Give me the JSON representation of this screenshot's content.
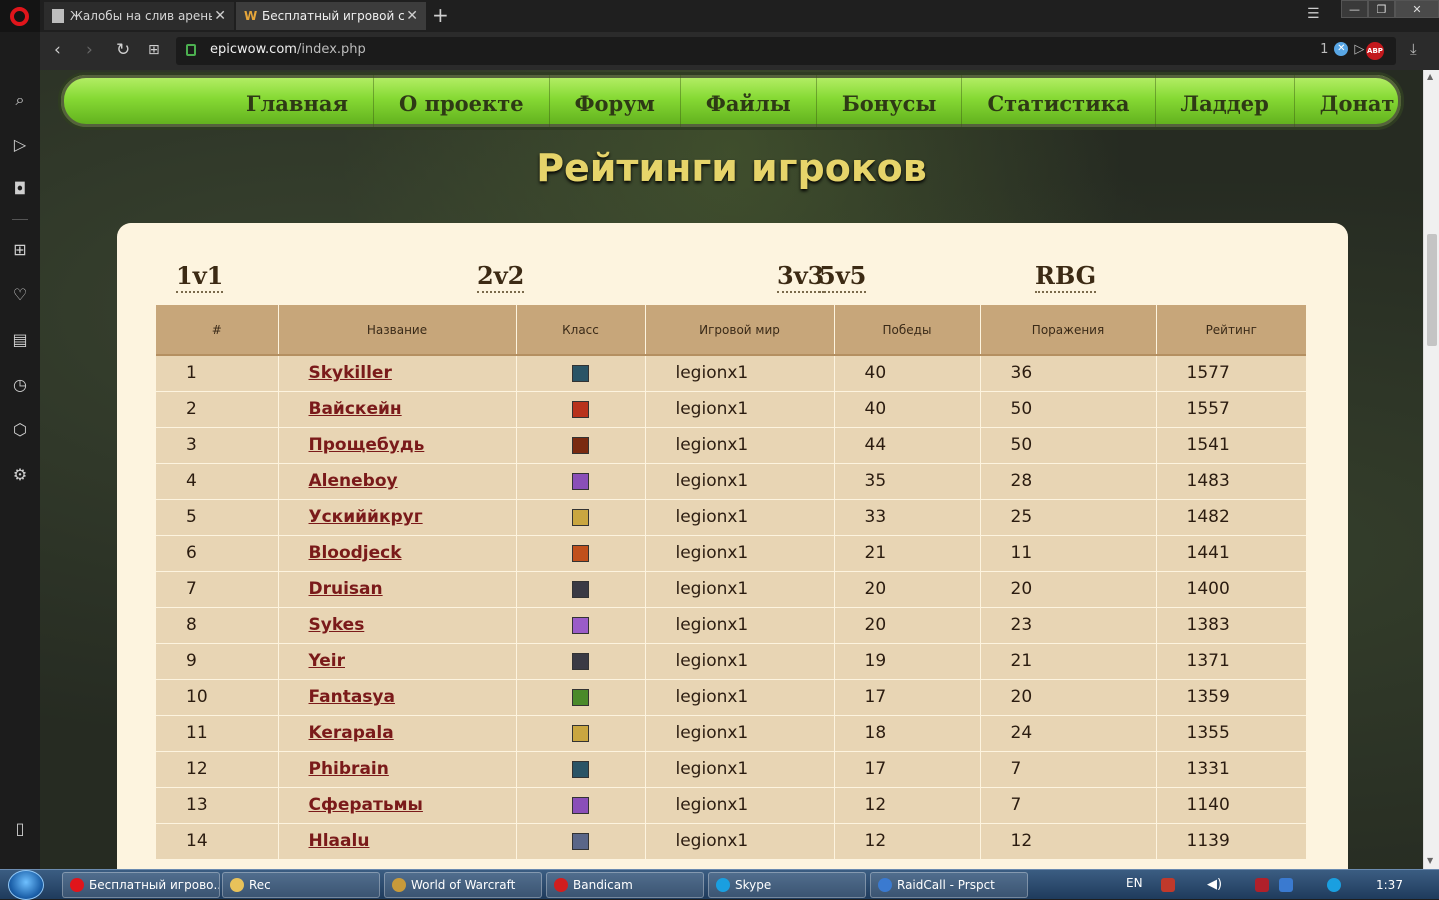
{
  "browser": {
    "tabs": [
      {
        "title": "Жалобы на слив арены - ",
        "favicon": "page-icon",
        "active": false
      },
      {
        "title": "Бесплатный игровой серв",
        "favicon": "W",
        "active": true
      }
    ],
    "url_domain": "epicwow.com",
    "url_path": "/index.php",
    "adblock_count": "1",
    "abp_label": "ABP"
  },
  "site": {
    "nav": [
      "Главная",
      "О проекте",
      "Форум",
      "Файлы",
      "Бонусы",
      "Статистика",
      "Ладдер",
      "Донат"
    ],
    "heading": "Рейтинги игроков",
    "brackets": [
      "1v1",
      "2v2",
      "3v3",
      "5v5",
      "RBG"
    ],
    "table": {
      "headers": [
        "#",
        "Название",
        "Класс",
        "Игровой мир",
        "Победы",
        "Поражения",
        "Рейтинг"
      ],
      "rows": [
        {
          "rank": "1",
          "name": "Skykiller",
          "class_color": "#2a5466",
          "realm": "legionx1",
          "wins": "40",
          "losses": "36",
          "rating": "1577"
        },
        {
          "rank": "2",
          "name": "Вайскейн",
          "class_color": "#b8321c",
          "realm": "legionx1",
          "wins": "40",
          "losses": "50",
          "rating": "1557"
        },
        {
          "rank": "3",
          "name": "Прощебудь",
          "class_color": "#7a2a10",
          "realm": "legionx1",
          "wins": "44",
          "losses": "50",
          "rating": "1541"
        },
        {
          "rank": "4",
          "name": "Aleneboy",
          "class_color": "#8a4fb8",
          "realm": "legionx1",
          "wins": "35",
          "losses": "28",
          "rating": "1483"
        },
        {
          "rank": "5",
          "name": "Ускиййкруг",
          "class_color": "#c9a640",
          "realm": "legionx1",
          "wins": "33",
          "losses": "25",
          "rating": "1482"
        },
        {
          "rank": "6",
          "name": "Bloodjeck",
          "class_color": "#c0501c",
          "realm": "legionx1",
          "wins": "21",
          "losses": "11",
          "rating": "1441"
        },
        {
          "rank": "7",
          "name": "Druisan",
          "class_color": "#3a3a44",
          "realm": "legionx1",
          "wins": "20",
          "losses": "20",
          "rating": "1400"
        },
        {
          "rank": "8",
          "name": "Sykes",
          "class_color": "#9a5cc8",
          "realm": "legionx1",
          "wins": "20",
          "losses": "23",
          "rating": "1383"
        },
        {
          "rank": "9",
          "name": "Yeir",
          "class_color": "#3a3a44",
          "realm": "legionx1",
          "wins": "19",
          "losses": "21",
          "rating": "1371"
        },
        {
          "rank": "10",
          "name": "Fantasya",
          "class_color": "#4a8a2a",
          "realm": "legionx1",
          "wins": "17",
          "losses": "20",
          "rating": "1359"
        },
        {
          "rank": "11",
          "name": "Kerapala",
          "class_color": "#c9a640",
          "realm": "legionx1",
          "wins": "18",
          "losses": "24",
          "rating": "1355"
        },
        {
          "rank": "12",
          "name": "Phibrain",
          "class_color": "#2a5466",
          "realm": "legionx1",
          "wins": "17",
          "losses": "7",
          "rating": "1331"
        },
        {
          "rank": "13",
          "name": "Сфератьмы",
          "class_color": "#8a4fb8",
          "realm": "legionx1",
          "wins": "12",
          "losses": "7",
          "rating": "1140"
        },
        {
          "rank": "14",
          "name": "Hlaalu",
          "class_color": "#5a6688",
          "realm": "legionx1",
          "wins": "12",
          "losses": "12",
          "rating": "1139"
        }
      ]
    }
  },
  "taskbar": {
    "items": [
      {
        "label": "Бесплатный игрово...",
        "icon_color": "#e0151b"
      },
      {
        "label": "Rec",
        "icon_color": "#e8c25a"
      },
      {
        "label": "World of Warcraft",
        "icon_color": "#c89a3a"
      },
      {
        "label": "Bandicam",
        "icon_color": "#d21e1e"
      },
      {
        "label": "Skype",
        "icon_color": "#1a9fe0"
      },
      {
        "label": "RaidCall - Prspct",
        "icon_color": "#3a7ad0"
      }
    ],
    "lang": "EN",
    "clock": "1:37"
  }
}
